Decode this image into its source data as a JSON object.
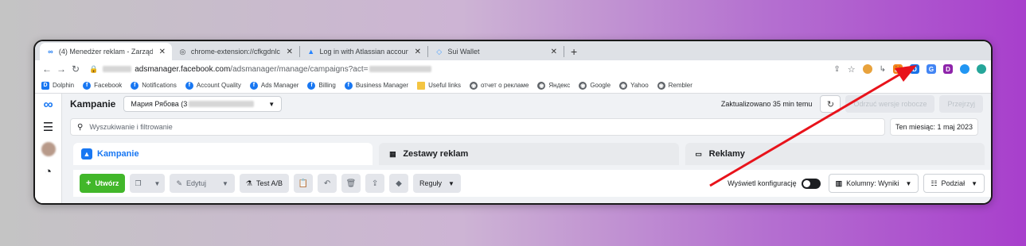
{
  "browser": {
    "tabs": [
      {
        "title": "(4) Menedżer reklam - Zarządzaj",
        "icon": "meta-icon"
      },
      {
        "title": "chrome-extension://cfkgdnlcieo",
        "icon": "extension-icon"
      },
      {
        "title": "Log in with Atlassian account",
        "icon": "atlassian-icon"
      },
      {
        "title": "Sui Wallet",
        "icon": "sui-icon"
      }
    ],
    "url_host": "adsmanager.facebook.com",
    "url_path": "/adsmanager/manage/campaigns?act=",
    "bookmarks": [
      {
        "label": "Dolphin",
        "color": "#1877f2"
      },
      {
        "label": "Facebook",
        "color": "#1877f2"
      },
      {
        "label": "Notifications",
        "color": "#1877f2"
      },
      {
        "label": "Account Quality",
        "color": "#1877f2"
      },
      {
        "label": "Ads Manager",
        "color": "#1877f2"
      },
      {
        "label": "Billing",
        "color": "#1877f2"
      },
      {
        "label": "Business Manager",
        "color": "#1877f2"
      },
      {
        "label": "Useful links",
        "color": "#f4c542"
      },
      {
        "label": "отчет о рекламе",
        "color": "#5f6368"
      },
      {
        "label": "Яндекс",
        "color": "#5f6368"
      },
      {
        "label": "Google",
        "color": "#5f6368"
      },
      {
        "label": "Yahoo",
        "color": "#5f6368"
      },
      {
        "label": "Rembler",
        "color": "#5f6368"
      }
    ]
  },
  "ads": {
    "page_title": "Kampanie",
    "account": "Мария Рябова (3",
    "updated": "Zaktualizowano 35 min temu",
    "discard_drafts": "Odrzuć wersje robocze",
    "review": "Przejrzyj",
    "search_placeholder": "Wyszukiwanie i filtrowanie",
    "date_range": "Ten miesiąc: 1 maj 2023",
    "levels": [
      "Kampanie",
      "Zestawy reklam",
      "Reklamy"
    ],
    "create": "Utwórz",
    "edit": "Edytuj",
    "ab_test": "Test A/B",
    "rules": "Reguły",
    "show_config": "Wyświetl konfigurację",
    "columns": "Kolumny: Wyniki",
    "breakdown": "Podział"
  },
  "colors": {
    "annotation_arrow": "#e8131b",
    "brand": "#1877f2",
    "create_button": "#42b72a"
  }
}
